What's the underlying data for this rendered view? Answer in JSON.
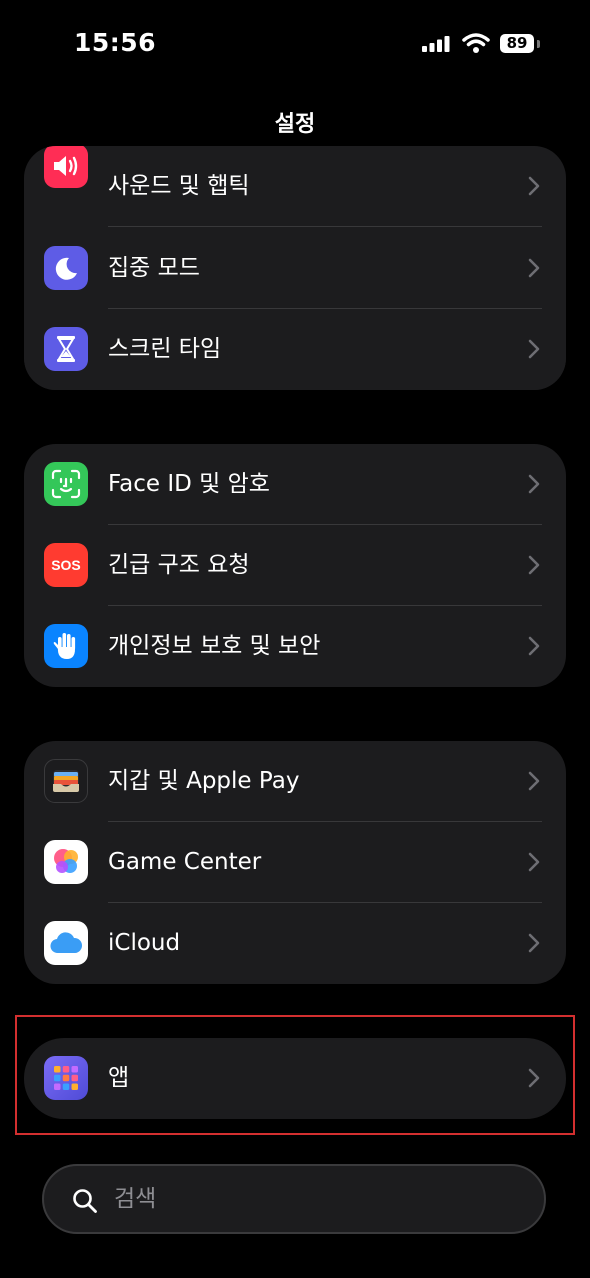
{
  "status": {
    "time": "15:56",
    "battery": "89"
  },
  "nav": {
    "title": "설정"
  },
  "groups": {
    "g1": [
      {
        "label": "사운드 및 햅틱",
        "icon": "speaker-icon",
        "color": "#ff2d55"
      },
      {
        "label": "집중 모드",
        "icon": "moon-icon",
        "color": "#5e5ce6"
      },
      {
        "label": "스크린 타임",
        "icon": "hourglass-icon",
        "color": "#5e5ce6"
      }
    ],
    "g2": [
      {
        "label": "Face ID 및 암호",
        "icon": "face-id-icon",
        "color": "#34c759"
      },
      {
        "label": "긴급 구조 요청",
        "icon": "sos-icon",
        "icon_text": "SOS",
        "color": "#ff3b30"
      },
      {
        "label": "개인정보 보호 및 보안",
        "icon": "hand-icon",
        "color": "#0a84ff"
      }
    ],
    "g3": [
      {
        "label": "지갑 및 Apple Pay",
        "icon": "wallet-icon",
        "color": "#1c1c1e"
      },
      {
        "label": "Game Center",
        "icon": "game-center-icon",
        "color": "#ffffff"
      },
      {
        "label": "iCloud",
        "icon": "icloud-icon",
        "color": "#ffffff"
      }
    ],
    "g4": [
      {
        "label": "앱",
        "icon": "apps-grid-icon",
        "color": "#5e5ce6"
      }
    ]
  },
  "search": {
    "placeholder": "검색"
  }
}
